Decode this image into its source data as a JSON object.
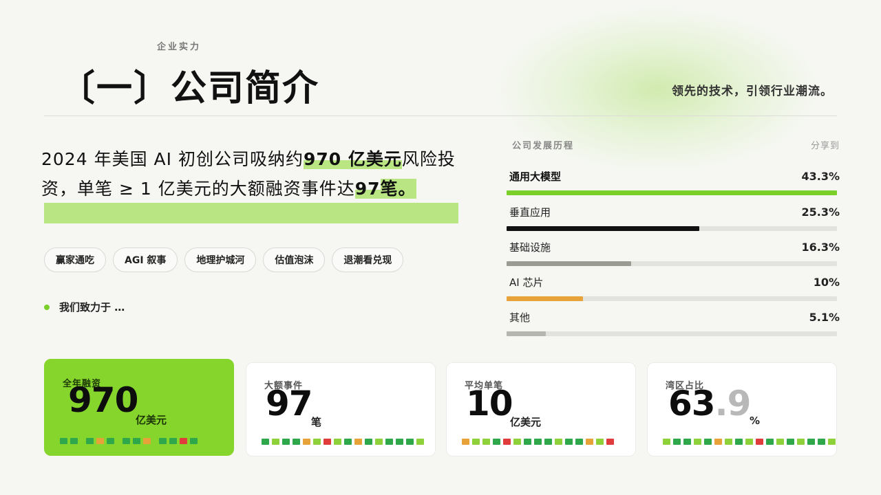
{
  "header": {
    "eyebrow": "企业实力",
    "title": "〔一〕公司简介",
    "slogan": "领先的技术，引领行业潮流。"
  },
  "lead": {
    "part1": "2024 年美国 AI 初创公司吸纳约",
    "hl1": "970 亿美元",
    "part2": "风险投资，单笔 ≥ 1 亿美元的大额融资事件达",
    "hl2": "97",
    "part3": "笔。"
  },
  "tags": [
    "赢家通吃",
    "AGI 叙事",
    "地理护城河",
    "估值泡沫",
    "退潮看兑现"
  ],
  "commitment": "我们致力于 …",
  "history": {
    "title": "公司发展历程",
    "share": "分享到",
    "rows": [
      {
        "label": "通用大模型",
        "pct": "43.3%",
        "value": 43.3,
        "color": "#7bcf2b",
        "active": true
      },
      {
        "label": "垂直应用",
        "pct": "25.3%",
        "value": 25.3,
        "color": "#111111",
        "active": false
      },
      {
        "label": "基础设施",
        "pct": "16.3%",
        "value": 16.3,
        "color": "#9a9c94",
        "active": false
      },
      {
        "label": "AI 芯片",
        "pct": "10%",
        "value": 10,
        "color": "#e8a23a",
        "active": false
      },
      {
        "label": "其他",
        "pct": "5.1%",
        "value": 5.1,
        "color": "#b5b6b0",
        "active": false
      }
    ]
  },
  "cards": [
    {
      "label": "全年融资",
      "value": "970",
      "frac": "",
      "unit": "亿美元"
    },
    {
      "label": "大额事件",
      "value": "97",
      "frac": "",
      "unit": "笔"
    },
    {
      "label": "平均单笔",
      "value": "10",
      "frac": "",
      "unit": "亿美元"
    },
    {
      "label": "湾区占比",
      "value": "63",
      "frac": ".9",
      "unit": "%"
    }
  ],
  "colors": {
    "accent": "#86d52c",
    "highlight": "#b9e583",
    "cell_green": "#2ea84a",
    "cell_lime": "#8fd13b",
    "cell_orange": "#e8a23a",
    "cell_red": "#e03c3c"
  }
}
